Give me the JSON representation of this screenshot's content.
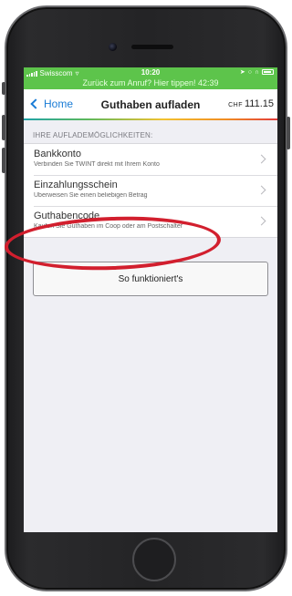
{
  "status_bar": {
    "carrier": "Swisscom",
    "time": "10:20",
    "call_banner": "Zurück zum Anruf? Hier tippen! 42:39"
  },
  "nav": {
    "back_label": "Home",
    "title": "Guthaben aufladen",
    "currency": "CHF",
    "balance": "111.15"
  },
  "section_header": "IHRE AUFLADEMÖGLICHKEITEN:",
  "options": [
    {
      "title": "Bankkonto",
      "subtitle": "Verbinden Sie TWINT direkt mit Ihrem Konto"
    },
    {
      "title": "Einzahlungsschein",
      "subtitle": "Überweisen Sie einen beliebigen Betrag"
    },
    {
      "title": "Guthabencode",
      "subtitle": "Kaufen Sie Guthaben im Coop oder am Postschalter"
    }
  ],
  "howto_button": "So funktioniert's",
  "colors": {
    "status_green": "#5dc44b",
    "link_blue": "#1a7cd6",
    "highlight_red": "#d21f2e"
  }
}
